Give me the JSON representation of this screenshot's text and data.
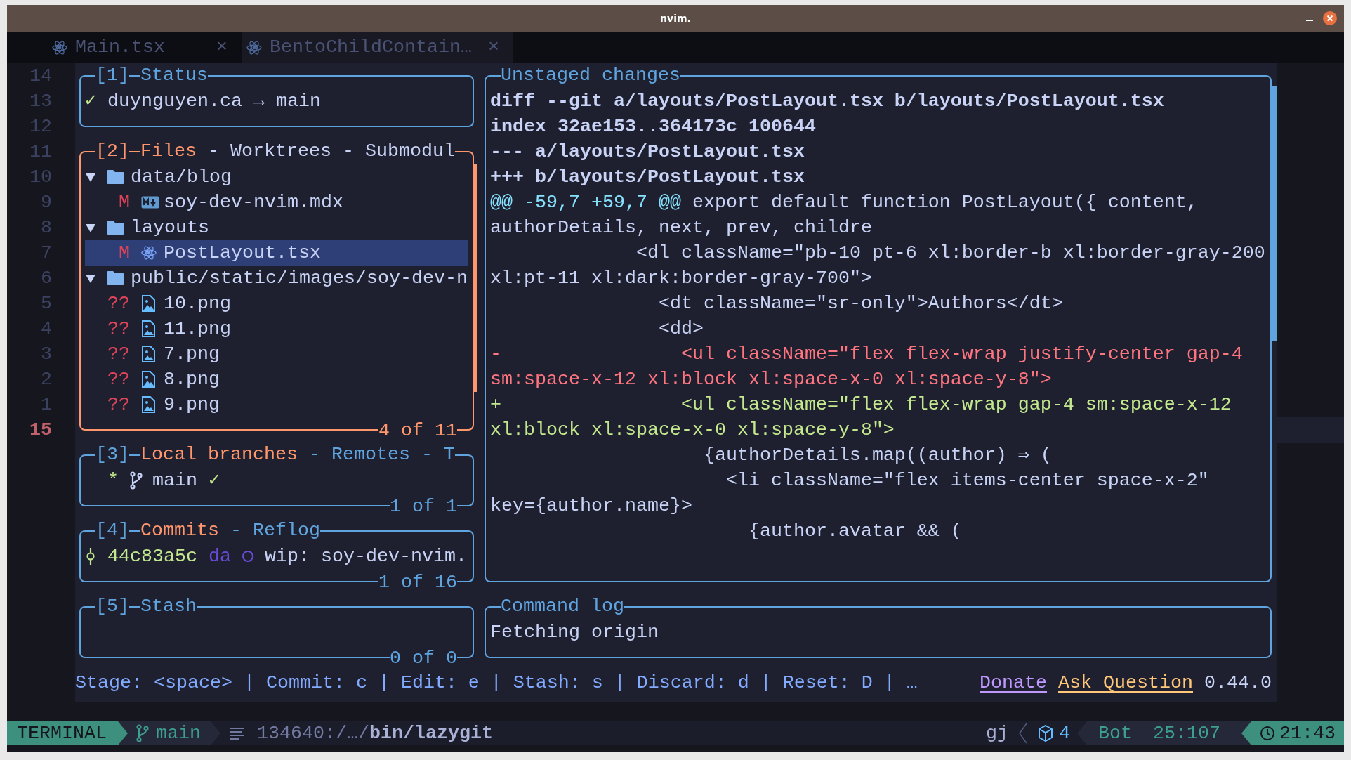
{
  "window": {
    "title": "nvim."
  },
  "tabs": [
    {
      "label": "Main.tsx",
      "close": "×",
      "selected": false
    },
    {
      "label": "BentoChildContain…",
      "close": "×",
      "selected": true
    }
  ],
  "line_numbers": [
    {
      "text": "14",
      "current": false
    },
    {
      "text": "13",
      "current": false
    },
    {
      "text": "12",
      "current": false
    },
    {
      "text": "11",
      "current": false
    },
    {
      "text": "10",
      "current": false
    },
    {
      "text": "9",
      "current": false
    },
    {
      "text": "8",
      "current": false
    },
    {
      "text": "7",
      "current": false
    },
    {
      "text": "6",
      "current": false
    },
    {
      "text": "5",
      "current": false
    },
    {
      "text": "4",
      "current": false
    },
    {
      "text": "3",
      "current": false
    },
    {
      "text": "2",
      "current": false
    },
    {
      "text": "1",
      "current": false
    },
    {
      "text": "15",
      "current": true
    }
  ],
  "status_panel": {
    "index": "[1]",
    "title": "Status",
    "focused": false,
    "check": "✓",
    "repo": "duynguyen.ca → main"
  },
  "files_panel": {
    "index": "[2]",
    "focused": true,
    "separator": "-",
    "footer": "4 of 11",
    "tabs": [
      {
        "label": "Files",
        "selected": true
      },
      {
        "label": "Worktrees",
        "selected": false
      },
      {
        "label": "Submodul",
        "selected": false
      }
    ],
    "tree": [
      {
        "kind": "folder",
        "name": "data/blog",
        "expanded": true,
        "selected": false,
        "children": [
          {
            "kind": "mdx",
            "status": "M",
            "name": "soy-dev-nvim.mdx",
            "selected": false
          }
        ]
      },
      {
        "kind": "folder",
        "name": "layouts",
        "expanded": true,
        "selected": false,
        "children": [
          {
            "kind": "tsx",
            "status": "M",
            "name": "PostLayout.tsx",
            "selected": true
          }
        ]
      },
      {
        "kind": "folder",
        "name": "public/static/images/soy-dev-n",
        "expanded": true,
        "selected": false,
        "children": [
          {
            "kind": "png",
            "status": "??",
            "name": "10.png",
            "selected": false
          },
          {
            "kind": "png",
            "status": "??",
            "name": "11.png",
            "selected": false
          },
          {
            "kind": "png",
            "status": "??",
            "name": "7.png",
            "selected": false
          },
          {
            "kind": "png",
            "status": "??",
            "name": "8.png",
            "selected": false
          },
          {
            "kind": "png",
            "status": "??",
            "name": "9.png",
            "selected": false
          }
        ]
      }
    ]
  },
  "branches_panel": {
    "index": "[3]",
    "focused": false,
    "separator": "-",
    "footer": "1 of 1",
    "tabs": [
      {
        "label": "Local branches",
        "selected": true
      },
      {
        "label": "Remotes",
        "selected": false
      },
      {
        "label": "T",
        "selected": false
      }
    ],
    "rows": [
      {
        "marker": "*",
        "name": "main",
        "check": "✓"
      }
    ]
  },
  "commits_panel": {
    "index": "[4]",
    "focused": false,
    "separator": "-",
    "footer": "1 of 16",
    "tabs": [
      {
        "label": "Commits",
        "selected": true
      },
      {
        "label": "Reflog",
        "selected": false
      }
    ],
    "rows": [
      {
        "hash": "44c83a5c",
        "author": "da",
        "message": "wip: soy-dev-nvim."
      }
    ]
  },
  "stash_panel": {
    "index": "[5]",
    "title": "Stash",
    "focused": false,
    "footer": "0 of 0"
  },
  "diff_panel": {
    "title": "Unstaged changes",
    "focused": false,
    "lines": [
      {
        "kind": "header",
        "text": "diff --git a/layouts/PostLayout.tsx b/layouts/PostLayout.tsx"
      },
      {
        "kind": "header",
        "text": "index 32ae153..364173c 100644"
      },
      {
        "kind": "header",
        "text": "--- a/layouts/PostLayout.tsx"
      },
      {
        "kind": "header",
        "text": "+++ b/layouts/PostLayout.tsx"
      },
      {
        "kind": "hunk",
        "range": "@@ -59,7 +59,7 @@",
        "text": " export default function PostLayout({ content,"
      },
      {
        "kind": "context",
        "text": "authorDetails, next, prev, childre"
      },
      {
        "kind": "context",
        "text": "             <dl className=\"pb-10 pt-6 xl:border-b xl:border-gray-200"
      },
      {
        "kind": "context",
        "text": "xl:pt-11 xl:dark:border-gray-700\">"
      },
      {
        "kind": "context",
        "text": "               <dt className=\"sr-only\">Authors</dt>"
      },
      {
        "kind": "context",
        "text": "               <dd>"
      },
      {
        "kind": "removed",
        "text": "-                <ul className=\"flex flex-wrap justify-center gap-4"
      },
      {
        "kind": "removed",
        "text": "sm:space-x-12 xl:block xl:space-x-0 xl:space-y-8\">"
      },
      {
        "kind": "added",
        "text": "+                <ul className=\"flex flex-wrap gap-4 sm:space-x-12"
      },
      {
        "kind": "added",
        "text": "xl:block xl:space-x-0 xl:space-y-8\">"
      },
      {
        "kind": "context",
        "text": "                   {authorDetails.map((author) ⇒ ("
      },
      {
        "kind": "context",
        "text": "                     <li className=\"flex items-center space-x-2\""
      },
      {
        "kind": "context",
        "text": "key={author.name}>"
      },
      {
        "kind": "context",
        "text": "                       {author.avatar && ("
      }
    ]
  },
  "command_log": {
    "title": "Command log",
    "focused": false,
    "lines": [
      "Fetching origin"
    ]
  },
  "hint_bar": {
    "keybindings": "Stage: <space> | Commit: c | Edit: e | Stash: s | Discard: d | Reset: D | …",
    "donate": "Donate",
    "ask": "Ask Question",
    "version": "0.44.0"
  },
  "status_line": {
    "mode": "TERMINAL",
    "branch": "main",
    "path": "134640:/…/**bin/lazygit**",
    "keys": "gj",
    "diagnostics": "4",
    "position": "Bot",
    "cursor": "25:107",
    "clock": "21:43"
  }
}
